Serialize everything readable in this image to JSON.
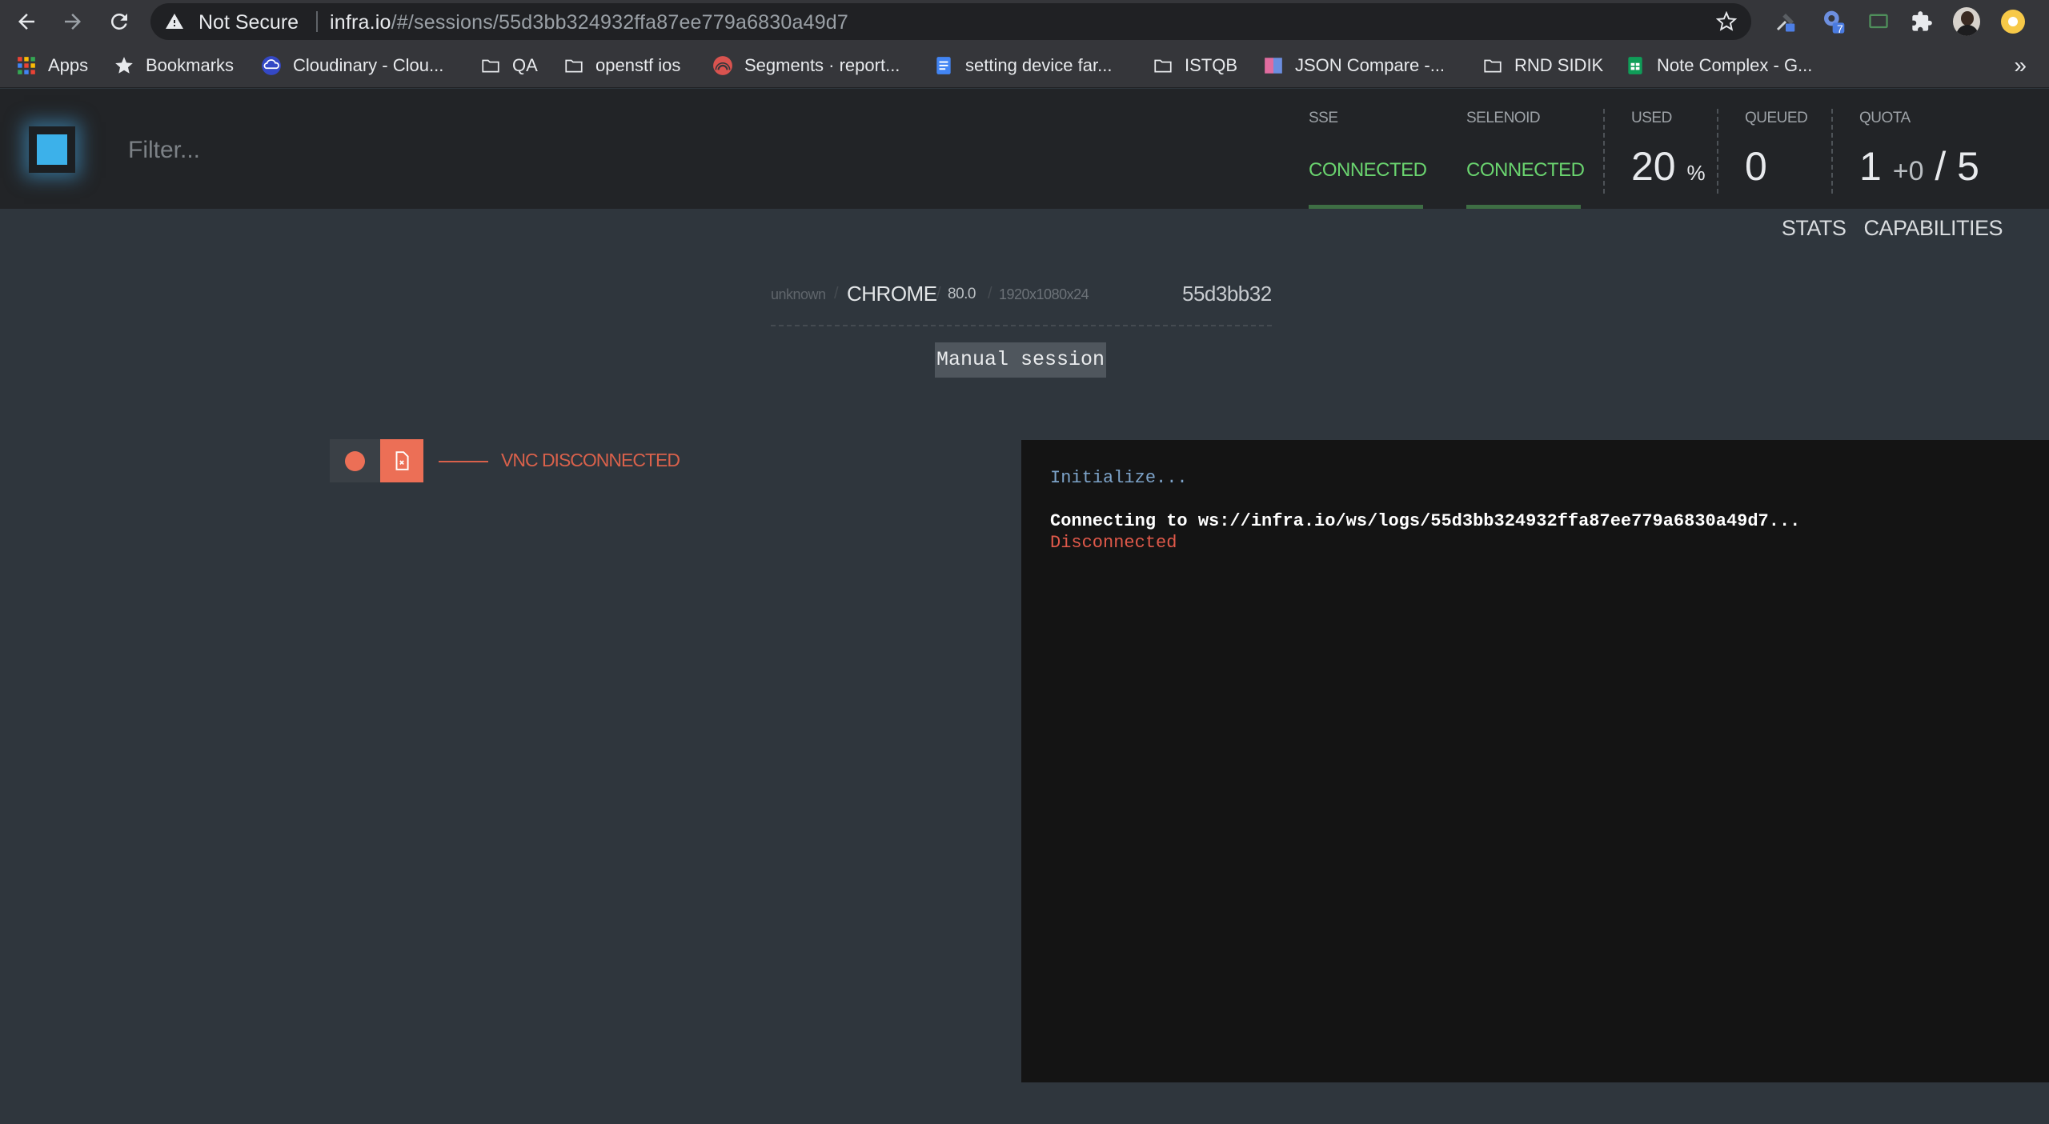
{
  "browser": {
    "security_label": "Not Secure",
    "url_host": "infra.io",
    "url_path": "/#/sessions/55d3bb324932ffa87ee779a6830a49d7",
    "extension_badge": "7"
  },
  "bookmarks": [
    {
      "label": "Apps",
      "icon": "apps-grid-icon"
    },
    {
      "label": "Bookmarks",
      "icon": "star-icon"
    },
    {
      "label": "Cloudinary - Clou...",
      "icon": "cloudinary-icon"
    },
    {
      "label": "QA",
      "icon": "folder-icon"
    },
    {
      "label": "openstf ios",
      "icon": "folder-icon"
    },
    {
      "label": "Segments · report...",
      "icon": "segments-icon"
    },
    {
      "label": "setting device far...",
      "icon": "docs-icon"
    },
    {
      "label": "ISTQB",
      "icon": "folder-icon"
    },
    {
      "label": "JSON Compare -...",
      "icon": "json-compare-icon"
    },
    {
      "label": "RND SIDIK",
      "icon": "folder-icon"
    },
    {
      "label": "Note Complex - G...",
      "icon": "sheets-icon"
    }
  ],
  "bookmarks_more": "»",
  "header": {
    "filter_placeholder": "Filter...",
    "sse": {
      "label": "SSE",
      "value": "CONNECTED"
    },
    "selenoid": {
      "label": "SELENOID",
      "value": "CONNECTED"
    },
    "used": {
      "label": "USED",
      "value": "20",
      "unit": "%"
    },
    "queued": {
      "label": "QUEUED",
      "value": "0"
    },
    "quota": {
      "label": "QUOTA",
      "used": "1",
      "pending": "+0",
      "total": "/ 5"
    }
  },
  "nav": {
    "stats": "STATS",
    "capabilities": "CAPABILITIES"
  },
  "session": {
    "platform": "unknown",
    "browser": "CHROME",
    "version": "80.0",
    "resolution": "1920x1080x24",
    "id_short": "55d3bb32",
    "manual_label": "Manual session"
  },
  "vnc": {
    "status": "VNC DISCONNECTED"
  },
  "log": {
    "init": "Initialize...",
    "connecting": "Connecting to ws://infra.io/ws/logs/55d3bb324932ffa87ee779a6830a49d7...",
    "disconnected": "Disconnected"
  },
  "colors": {
    "accent": "#3cb1ea",
    "connected": "#6ad46f",
    "error": "#ec6f56"
  }
}
